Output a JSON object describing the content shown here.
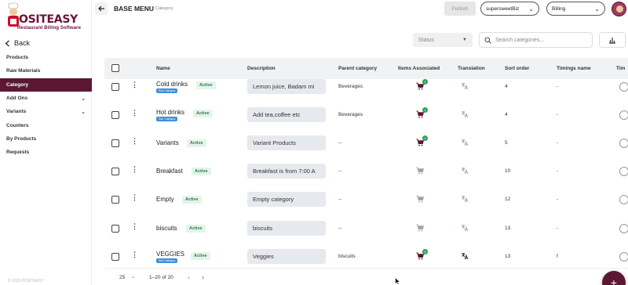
{
  "brand": {
    "name": "OSITEASY",
    "tagline": "Restaurant Billing Software",
    "color": "#5c1733"
  },
  "sidebar": {
    "back_label": "Back",
    "items": [
      {
        "label": "Products",
        "has_chevron": false,
        "active": false
      },
      {
        "label": "Raw Materials",
        "has_chevron": false,
        "active": false
      },
      {
        "label": "Category",
        "has_chevron": false,
        "active": true
      },
      {
        "label": "Add Ons",
        "has_chevron": true,
        "active": false
      },
      {
        "label": "Variants",
        "has_chevron": true,
        "active": false
      },
      {
        "label": "Counters",
        "has_chevron": false,
        "active": false
      },
      {
        "label": "By Products",
        "has_chevron": false,
        "active": false
      },
      {
        "label": "Requests",
        "has_chevron": false,
        "active": false
      }
    ]
  },
  "header": {
    "title": "BASE MENU",
    "subtitle": "Category",
    "publish_label": "Publish",
    "business_select": "supersweetBiz",
    "mode_select": "Billing"
  },
  "filters": {
    "status_placeholder": "Status",
    "search_placeholder": "Search categories..."
  },
  "table": {
    "columns": {
      "name": "Name",
      "description": "Description",
      "parent": "Parent category",
      "items": "Items Associated",
      "translation": "Translation",
      "sort": "Sort order",
      "timings": "Timings name",
      "timings_cut": "Tim"
    },
    "active_label": "Active",
    "sub_label": "Sub Category",
    "rows": [
      {
        "name": "Cold drinks",
        "sub": true,
        "description": "Lemon juice, Badam mi",
        "parent": "Beverages",
        "count": "1",
        "translated": false,
        "sort": "4",
        "timings": "-"
      },
      {
        "name": "Hot drinks",
        "sub": true,
        "description": "Add tea,coffee etc",
        "parent": "Beverages",
        "count": "1",
        "translated": false,
        "sort": "4",
        "timings": "-"
      },
      {
        "name": "Variants",
        "sub": false,
        "description": "Variant Products",
        "parent": "--",
        "count": "2",
        "translated": false,
        "sort": "5",
        "timings": "-"
      },
      {
        "name": "Breakfast",
        "sub": false,
        "description": "Breakfast is from 7:00 A",
        "parent": "--",
        "count": "",
        "translated": false,
        "sort": "10",
        "timings": "-"
      },
      {
        "name": "Empty",
        "sub": false,
        "description": "Empty category",
        "parent": "--",
        "count": "",
        "translated": false,
        "sort": "12",
        "timings": "-"
      },
      {
        "name": "biscuits",
        "sub": false,
        "description": "biscuits",
        "parent": "--",
        "count": "",
        "translated": false,
        "sort": "13",
        "timings": "-"
      },
      {
        "name": "VEGGIES",
        "sub": true,
        "description": "Veggies",
        "parent": "biscuits",
        "count": "6",
        "translated": true,
        "sort": "13",
        "timings": "f"
      }
    ]
  },
  "pagination": {
    "page_size": "25",
    "range": "1–20 of 20"
  },
  "footer_text": "© 2023 POSITEASY",
  "colors": {
    "active_bg": "#e4f4ea",
    "active_text": "#2f7a49",
    "cart_filled": "#5c1733",
    "cart_empty": "#9aa4ae",
    "count_badge": "#2fa15a"
  }
}
